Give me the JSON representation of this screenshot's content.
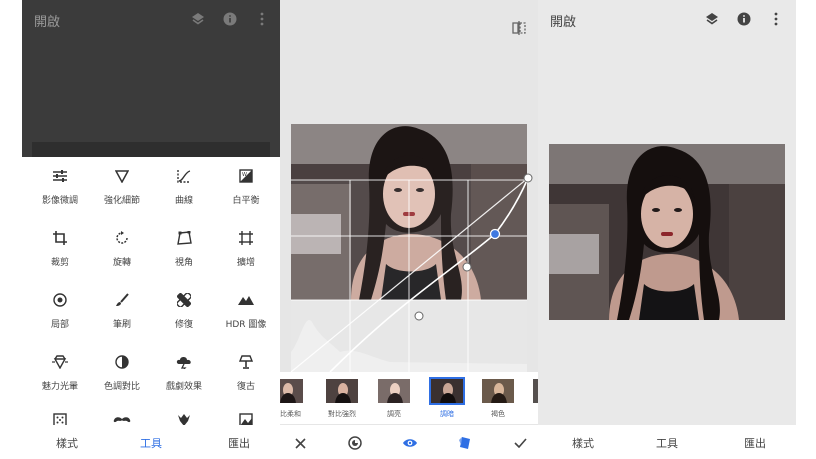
{
  "panel1": {
    "title": "開啟",
    "icons": [
      "layers-icon",
      "info-icon",
      "more-vert-icon"
    ],
    "tools": [
      {
        "label": "影像微調",
        "icon": "tune-icon"
      },
      {
        "label": "強化細節",
        "icon": "details-triangle-icon"
      },
      {
        "label": "曲線",
        "icon": "curves-icon"
      },
      {
        "label": "白平衡",
        "icon": "white-balance-icon"
      },
      {
        "label": "裁剪",
        "icon": "crop-icon"
      },
      {
        "label": "旋轉",
        "icon": "rotate-icon"
      },
      {
        "label": "視角",
        "icon": "perspective-icon"
      },
      {
        "label": "擴增",
        "icon": "expand-icon"
      },
      {
        "label": "局部",
        "icon": "selective-icon"
      },
      {
        "label": "筆刷",
        "icon": "brush-icon"
      },
      {
        "label": "修復",
        "icon": "healing-icon"
      },
      {
        "label": "HDR 圖像",
        "icon": "hdr-mountain-icon"
      },
      {
        "label": "魅力光暈",
        "icon": "glamour-glow-icon"
      },
      {
        "label": "色調對比",
        "icon": "tonal-contrast-icon"
      },
      {
        "label": "戲劇效果",
        "icon": "drama-cloud-icon"
      },
      {
        "label": "復古",
        "icon": "vintage-lamp-icon"
      },
      {
        "label": "",
        "icon": "grainy-film-icon"
      },
      {
        "label": "",
        "icon": "retrolux-mustache-icon"
      },
      {
        "label": "",
        "icon": "grunge-icon"
      },
      {
        "label": "",
        "icon": "black-white-icon"
      }
    ],
    "nav": {
      "styles": "樣式",
      "tools": "工具",
      "export": "匯出"
    }
  },
  "panel2": {
    "presets": [
      {
        "label": "對比柔和",
        "selected": false
      },
      {
        "label": "對比強烈",
        "selected": false
      },
      {
        "label": "調亮",
        "selected": false
      },
      {
        "label": "調暗",
        "selected": true
      },
      {
        "label": "褐色",
        "selected": false
      }
    ],
    "actions": [
      "close-icon",
      "channel-icon",
      "eye-icon",
      "styles-icon",
      "check-icon"
    ]
  },
  "panel3": {
    "title": "開啟",
    "nav": {
      "styles": "樣式",
      "tools": "工具",
      "export": "匯出"
    }
  },
  "colors": {
    "accent": "#2f6fe4",
    "dim_overlay": "#3b3b3b"
  }
}
